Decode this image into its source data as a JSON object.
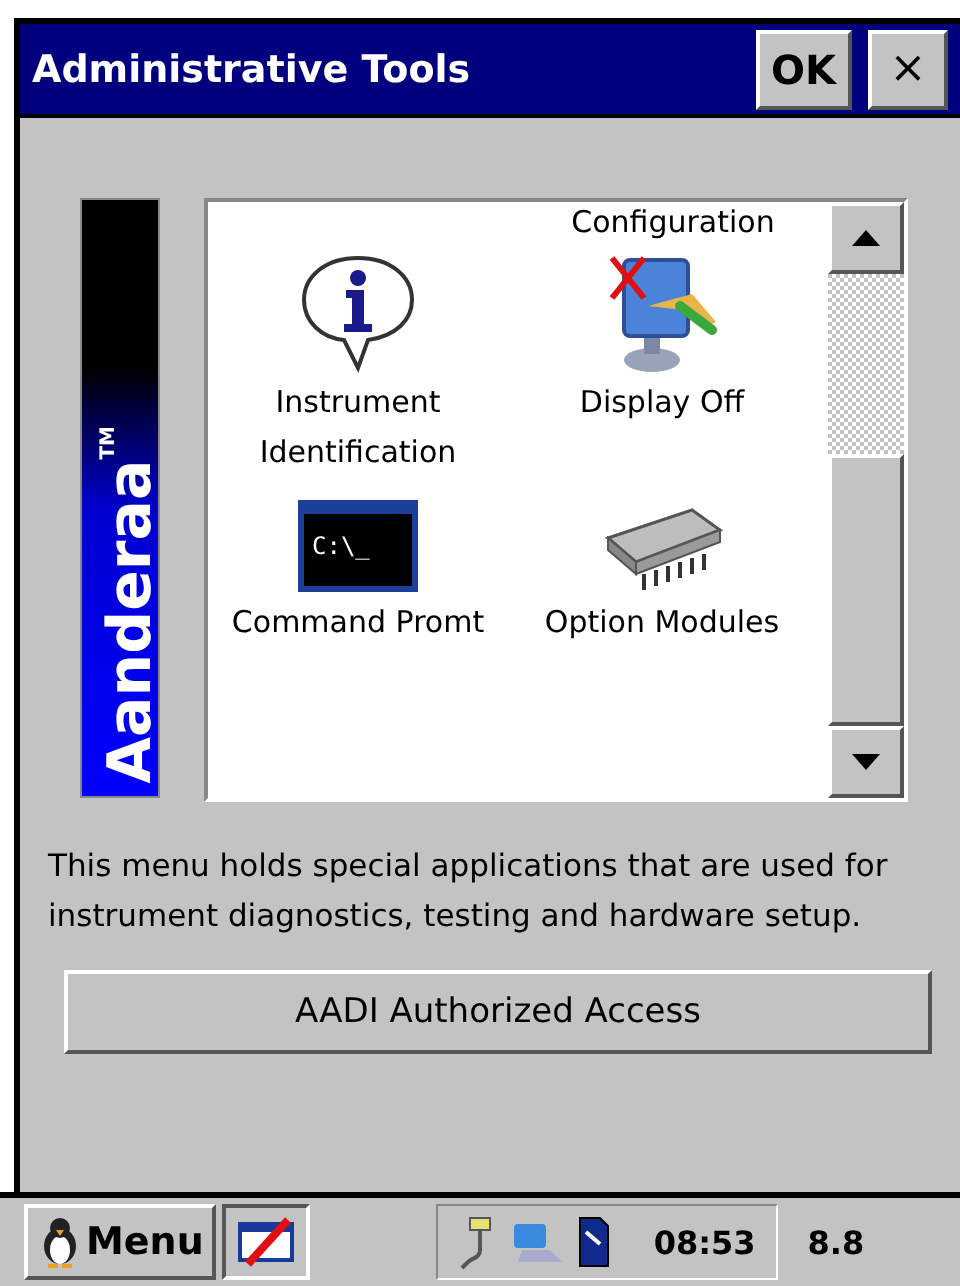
{
  "window": {
    "title": "Administrative Tools",
    "ok_button": "OK",
    "close_button": "×"
  },
  "logo": {
    "text": "Aanderaa",
    "trademark": "TM"
  },
  "icon_list": {
    "cut_off_label": "Configuration",
    "items": [
      {
        "label": "Instrument Identification"
      },
      {
        "label": "Display Off"
      },
      {
        "label": "Command Promt",
        "icon_text": "C:\\_"
      },
      {
        "label": "Option Modules"
      }
    ]
  },
  "description": "This menu holds special applications that are used for instrument diagnostics, testing and hardware setup.",
  "access_button": "AADI Authorized Access",
  "taskbar": {
    "menu_button": "Menu",
    "clock": "08:53",
    "indicator": "8.8"
  }
}
